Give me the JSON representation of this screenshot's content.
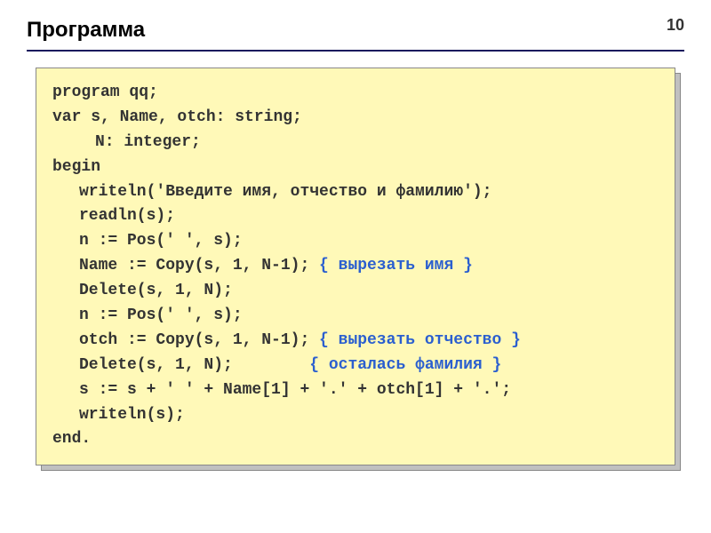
{
  "page_number": "10",
  "title": "Программа",
  "code": {
    "line1": "program qq;",
    "line2": "var s, Name, otch: string;",
    "line3": "N: integer;",
    "line4": "begin",
    "line5": "writeln('Введите имя, отчество и фамилию');",
    "line6": "readln(s);",
    "line7": "n := Pos(' ', s);",
    "line8a": "Name := Copy(s, 1, N-1); ",
    "line8b": "{ вырезать имя }",
    "line9": "Delete(s, 1, N);",
    "line10": "n := Pos(' ', s);",
    "line11a": "otch := Copy(s, 1, N-1); ",
    "line11b": "{ вырезать отчество }",
    "line12a": "Delete(s, 1, N);        ",
    "line12b": "{ осталась фамилия }",
    "line13": "s := s + ' ' + Name[1] + '.' + otch[1] + '.';",
    "line14": "writeln(s);",
    "line15": "end."
  }
}
